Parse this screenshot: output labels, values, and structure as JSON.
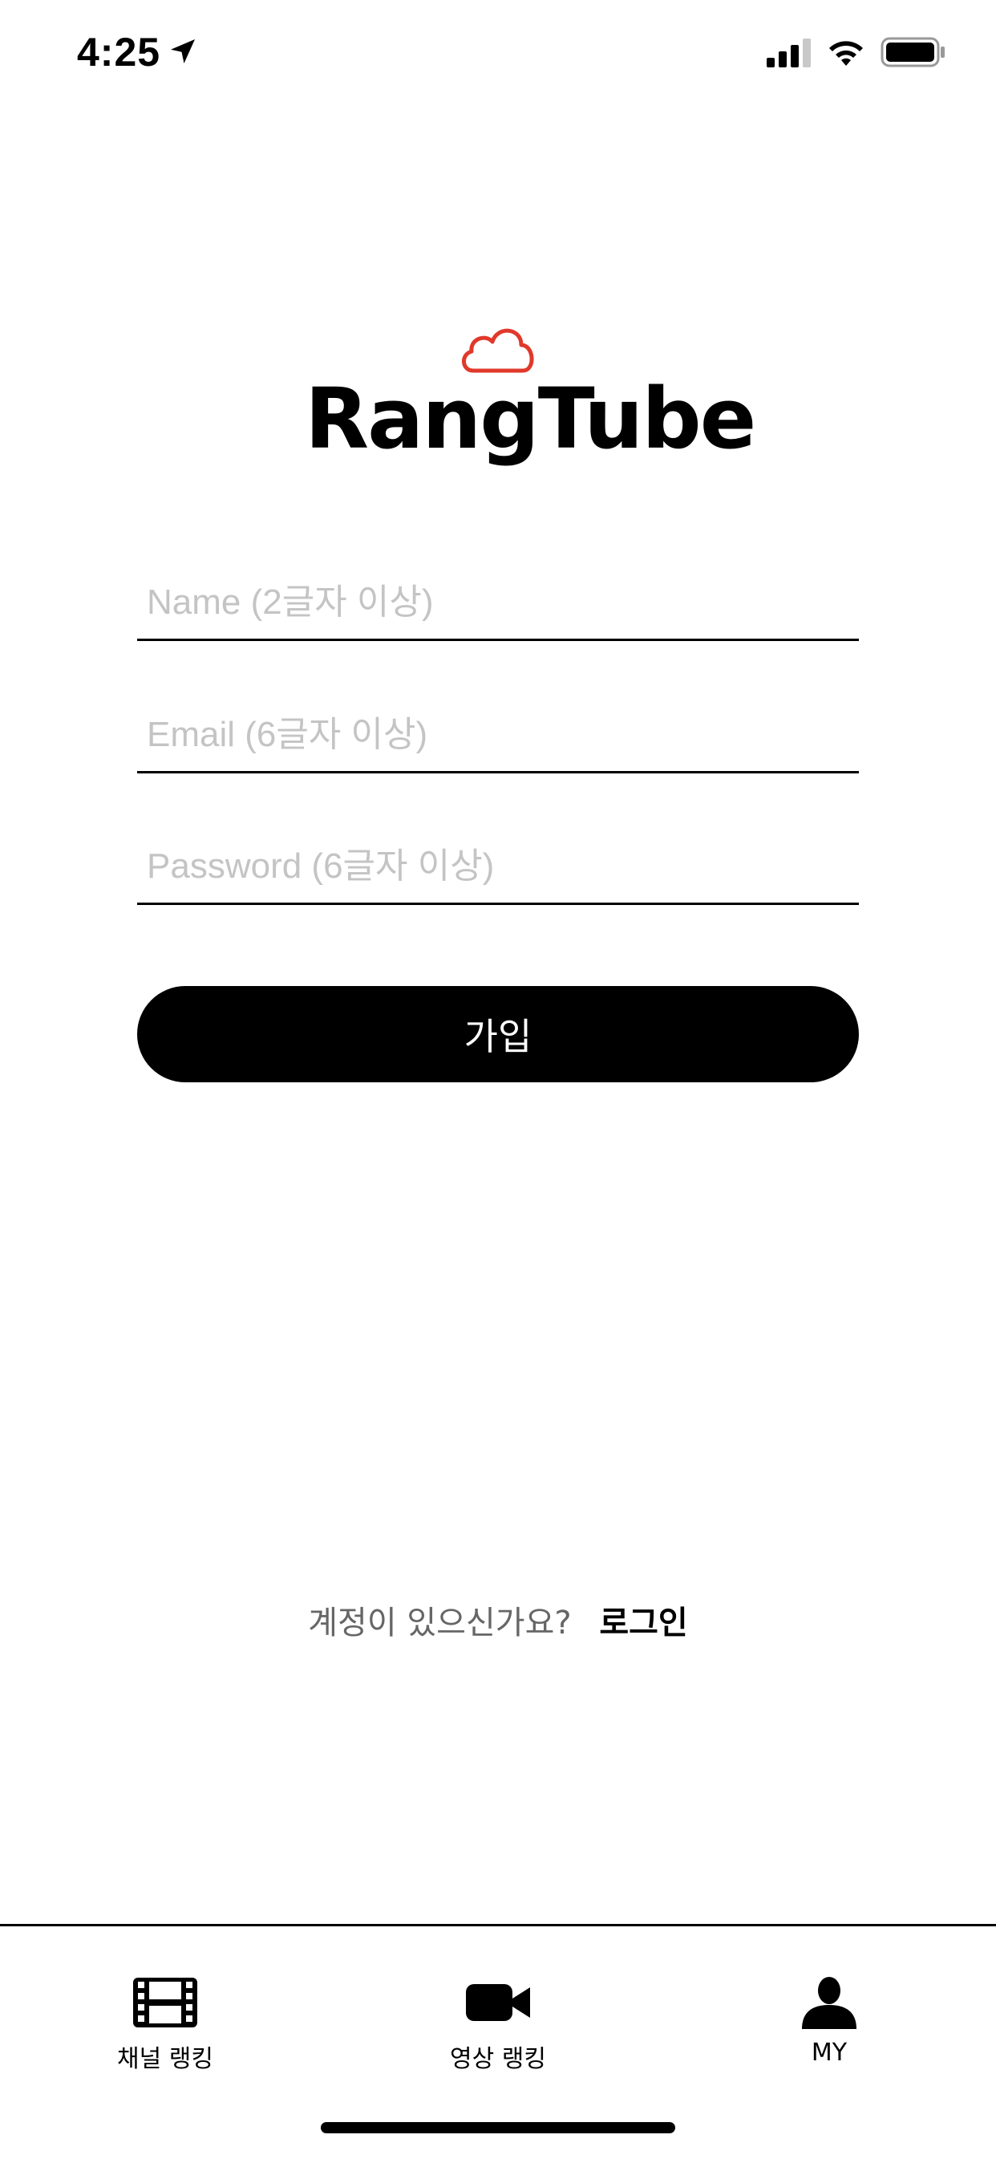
{
  "status_bar": {
    "time": "4:25",
    "icons": [
      "location-arrow-icon",
      "cellular-signal-icon",
      "wifi-icon",
      "battery-icon"
    ]
  },
  "logo": {
    "text": "RangTube",
    "icon": "cloud-icon",
    "cloud_color": "#e0392b"
  },
  "form": {
    "name_placeholder": "Name (2글자 이상)",
    "email_placeholder": "Email (6글자 이상)",
    "password_placeholder": "Password (6글자 이상)",
    "signup_label": "가입"
  },
  "login_prompt": {
    "question": "계정이 있으신가요?",
    "link_label": "로그인"
  },
  "tab_bar": {
    "tabs": [
      {
        "label": "채널 랭킹",
        "icon": "film-strip-icon"
      },
      {
        "label": "영상 랭킹",
        "icon": "video-camera-icon"
      },
      {
        "label": "MY",
        "icon": "person-icon"
      }
    ]
  },
  "colors": {
    "accent": "#000000",
    "placeholder": "#c4c4c4",
    "background": "#ffffff"
  }
}
